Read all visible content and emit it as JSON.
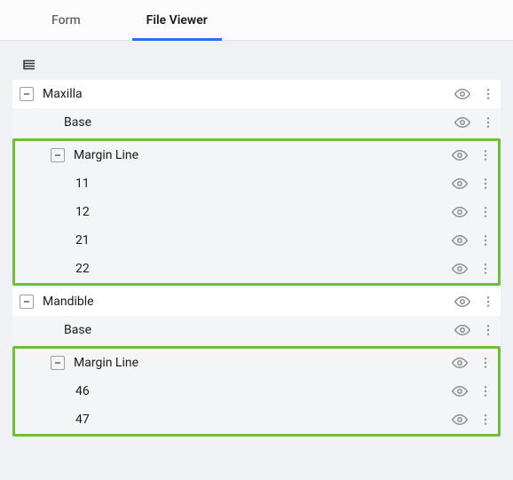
{
  "tabs": {
    "form": "Form",
    "file_viewer": "File Viewer"
  },
  "tree": {
    "maxilla": {
      "label": "Maxilla",
      "base": "Base",
      "margin_line": {
        "label": "Margin Line",
        "items": [
          "11",
          "12",
          "21",
          "22"
        ]
      }
    },
    "mandible": {
      "label": "Mandible",
      "base": "Base",
      "margin_line": {
        "label": "Margin Line",
        "items": [
          "46",
          "47"
        ]
      }
    }
  },
  "colors": {
    "highlight_border": "#6bbf3a",
    "active_tab": "#2b6ef2"
  }
}
